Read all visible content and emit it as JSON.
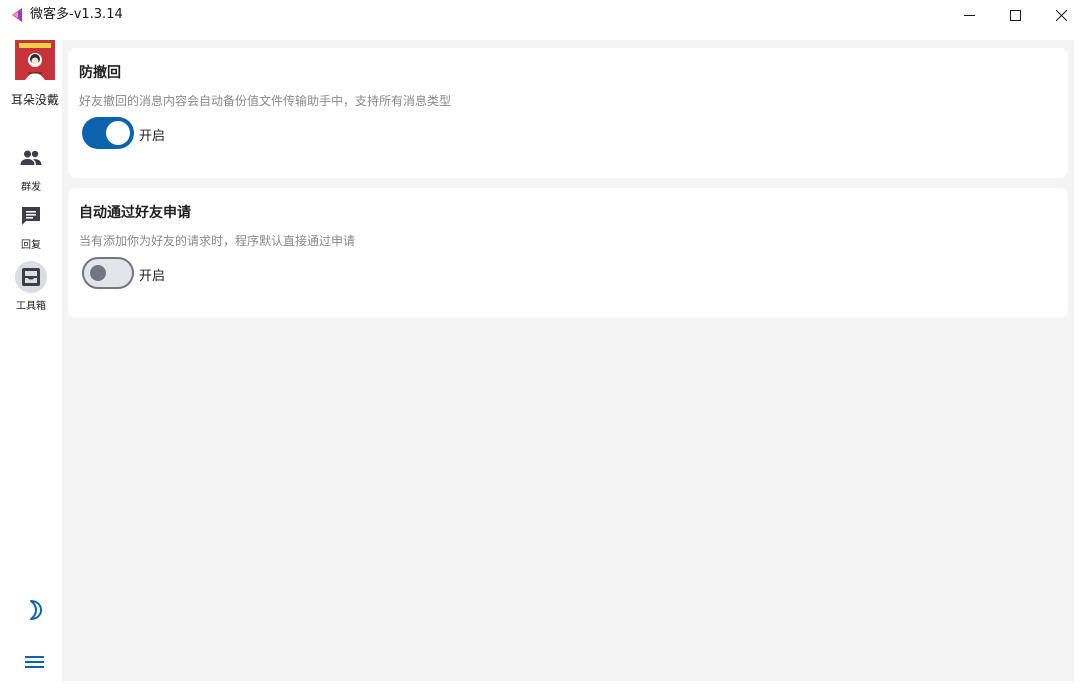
{
  "window": {
    "title": "微客多-v1.3.14",
    "app_icon": "app-logo-icon",
    "controls": [
      "minimize-icon",
      "maximize-icon",
      "close-icon"
    ]
  },
  "sidebar": {
    "user": {
      "name": "耳朵没戴",
      "avatar": "avatar-image"
    },
    "items": [
      {
        "label": "群发",
        "icon": "people-icon",
        "active": false
      },
      {
        "label": "回复",
        "icon": "chat-icon",
        "active": false
      },
      {
        "label": "工具箱",
        "icon": "toolbox-icon",
        "active": true
      }
    ],
    "bottom": [
      {
        "icon": "moon-icon"
      },
      {
        "icon": "menu-icon"
      }
    ]
  },
  "settings": [
    {
      "title": "防撤回",
      "description": "好友撤回的消息内容会自动备份值文件传输助手中，支持所有消息类型",
      "toggle_label": "开启",
      "enabled": true
    },
    {
      "title": "自动通过好友申请",
      "description": "当有添加你为好友的请求时，程序默认直接通过申请",
      "toggle_label": "开启",
      "enabled": false
    }
  ],
  "colors": {
    "accent": "#0b63ad",
    "content_bg": "#f4f4f4",
    "avatar_bg": "#c8323a"
  }
}
